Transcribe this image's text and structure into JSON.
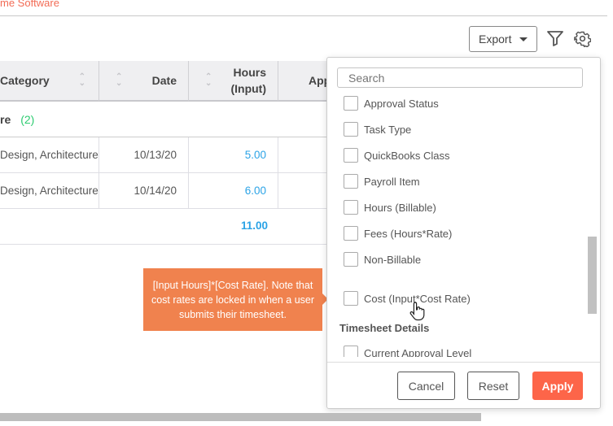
{
  "brand": "me Software",
  "toolbar": {
    "export_label": "Export",
    "filter_icon": "filter-icon",
    "settings_icon": "gear-icon"
  },
  "table": {
    "headers": [
      "Category",
      "Date",
      "Hours\n(Input)",
      "App"
    ],
    "group": {
      "label": "re",
      "count": "(2)"
    },
    "rows": [
      {
        "category": "Design, Architecture",
        "date": "10/13/20",
        "hours": "5.00"
      },
      {
        "category": "Design, Architecture",
        "date": "10/14/20",
        "hours": "6.00"
      }
    ],
    "total_hours": "11.00"
  },
  "column_picker": {
    "search_placeholder": "Search",
    "items": [
      "Approval Status",
      "Task Type",
      "QuickBooks Class",
      "Payroll Item",
      "Hours (Billable)",
      "Fees (Hours*Rate)",
      "Non-Billable",
      "Cost (Input*Cost Rate)"
    ],
    "section_heading": "Timesheet Details",
    "section_items": [
      "Current Approval Level"
    ],
    "cancel_label": "Cancel",
    "reset_label": "Reset",
    "apply_label": "Apply"
  },
  "tooltip": "[Input Hours]*[Cost Rate]. Note that cost rates are locked in when a user submits their timesheet.",
  "colors": {
    "accent": "#fd6549",
    "tooltip": "#f0824e",
    "link": "#2ba3e6",
    "count": "#2ecc71"
  }
}
